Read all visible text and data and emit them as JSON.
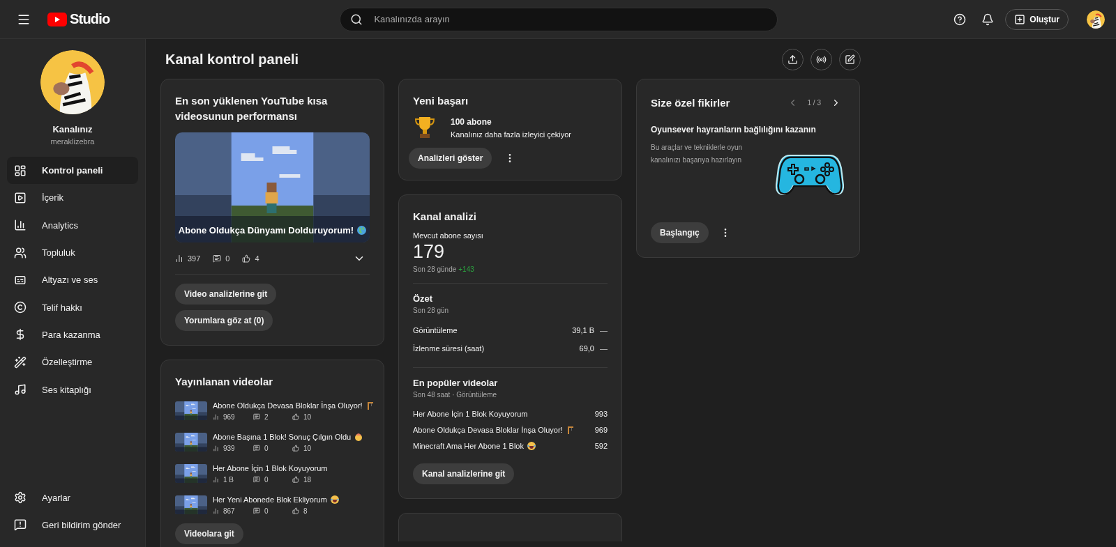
{
  "topbar": {
    "logo_text": "Studio",
    "search": {
      "placeholder": "Kanalınızda arayın"
    },
    "create_button": "Oluştur"
  },
  "sidebar": {
    "channel_title": "Kanalınız",
    "channel_handle": "meraklizebra",
    "nav": [
      {
        "label": "Kontrol paneli",
        "selected": true
      },
      {
        "label": "İçerik",
        "selected": false
      },
      {
        "label": "Analytics",
        "selected": false
      },
      {
        "label": "Topluluk",
        "selected": false
      },
      {
        "label": "Altyazı ve ses",
        "selected": false
      },
      {
        "label": "Telif hakkı",
        "selected": false
      },
      {
        "label": "Para kazanma",
        "selected": false
      },
      {
        "label": "Özelleştirme",
        "selected": false
      },
      {
        "label": "Ses kitaplığı",
        "selected": false
      }
    ],
    "footer": [
      {
        "label": "Ayarlar"
      },
      {
        "label": "Geri bildirim gönder"
      }
    ]
  },
  "page_title": "Kanal kontrol paneli",
  "latest_short": {
    "title": "En son yüklenen YouTube kısa videosunun performansı",
    "video": {
      "title": "Abone Oldukça Dünyamı Dolduruyorum!",
      "kind": "globe"
    },
    "views": "397",
    "comments": "0",
    "likes": "4",
    "buttons": [
      "Video analizlerine git",
      "Yorumlara göz at (0)"
    ]
  },
  "published": {
    "title": "Yayınlanan videolar",
    "videos": [
      {
        "title": "Abone Oldukça Devasa Bloklar İnşa Oluyor!",
        "kind": "crane",
        "views": "969",
        "comments": "2",
        "likes": "10"
      },
      {
        "title": "Abone Başına 1 Blok! Sonuç Çılgın Oldu",
        "kind": "shock",
        "views": "939",
        "comments": "0",
        "likes": "10"
      },
      {
        "title": "Her Abone İçin 1 Blok Koyuyorum",
        "kind": "plain",
        "views": "1 B",
        "comments": "0",
        "likes": "18"
      },
      {
        "title": "Her Yeni Abonede Blok Ekliyorum",
        "kind": "laugh",
        "views": "867",
        "comments": "0",
        "likes": "8"
      }
    ],
    "button": "Videolara git"
  },
  "achievement": {
    "title": "Yeni başarı",
    "headline": "100 abone",
    "text": "Kanalınız daha fazla izleyici çekiyor",
    "button": "Analizleri göster"
  },
  "analytics": {
    "title": "Kanal analizi",
    "subscribers_label": "Mevcut abone sayısı",
    "subscribers": "179",
    "period": "Son 28 günde",
    "change": "+143",
    "summary_title": "Özet",
    "summary_period": "Son 28 gün",
    "metrics": [
      {
        "label": "Görüntüleme",
        "value": "39,1 B",
        "trend": "—"
      },
      {
        "label": "İzlenme süresi (saat)",
        "value": "69,0",
        "trend": "—"
      }
    ],
    "top_title": "En popüler videolar",
    "top_period": "Son 48 saat · Görüntüleme",
    "top_videos": [
      {
        "title": "Her Abone İçin 1 Blok Koyuyorum",
        "kind": "plain",
        "views": "993"
      },
      {
        "title": "Abone Oldukça Devasa Bloklar İnşa Oluyor!",
        "kind": "crane",
        "views": "969"
      },
      {
        "title": "Minecraft Ama Her Abone 1 Blok",
        "kind": "laugh",
        "views": "592"
      }
    ],
    "button": "Kanal analizlerine git"
  },
  "ideas": {
    "title": "Size özel fikirler",
    "pager": "1 / 3",
    "headline": "Oyunsever hayranların bağlılığını kazanın",
    "text": "Bu araçlar ve tekniklerle oyun kanalınızı başarıya hazırlayın",
    "button": "Başlangıç"
  }
}
